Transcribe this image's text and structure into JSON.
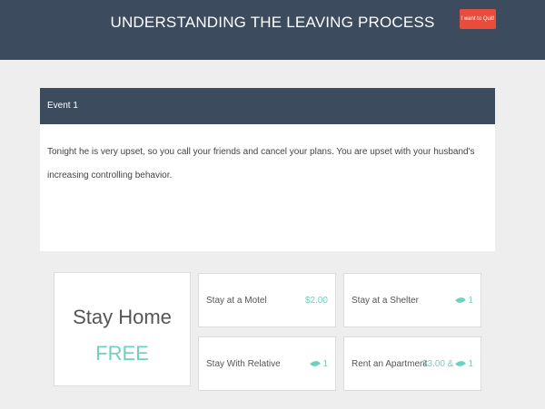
{
  "header": {
    "title": "UNDERSTANDING THE LEAVING PROCESS",
    "quit_label": "I want to Quit!"
  },
  "event": {
    "title": "Event 1",
    "text": "Tonight he is very upset, so you call your friends and cancel your plans. You are upset with your husband's increasing controlling behavior."
  },
  "options": {
    "home": {
      "label": "Stay Home",
      "price": "FREE"
    },
    "motel": {
      "label": "Stay at a Motel",
      "price": "$2.00"
    },
    "shelter": {
      "label": "Stay at a Shelter",
      "price": "1",
      "price_icon": "leaf-icon"
    },
    "relative": {
      "label": "Stay With Relative",
      "price": "1",
      "price_icon": "leaf-icon"
    },
    "apartment": {
      "label": "Rent an Apartment",
      "price_prefix": "$3.00 &",
      "price": "1",
      "price_icon": "leaf-icon"
    }
  },
  "colors": {
    "header_bg": "#3d4b5e",
    "quit_button": "#e84c3d",
    "accent": "#6ed1c0",
    "page_bg": "#eeeeee"
  }
}
